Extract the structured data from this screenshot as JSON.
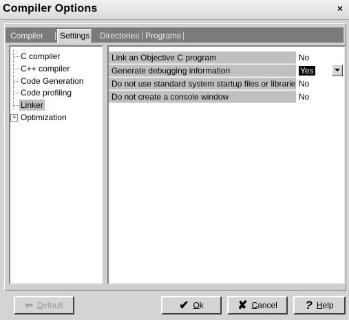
{
  "window": {
    "title": "Compiler Options",
    "close_glyph": "×"
  },
  "tabs": [
    {
      "label": "Compiler"
    },
    {
      "label": "Settings",
      "active": true
    },
    {
      "label": "Directories"
    },
    {
      "label": "Programs"
    }
  ],
  "tree": {
    "items": [
      {
        "label": "C compiler"
      },
      {
        "label": "C++ compiler"
      },
      {
        "label": "Code Generation"
      },
      {
        "label": "Code profiling"
      },
      {
        "label": "Linker",
        "selected": true
      },
      {
        "label": "Optimization",
        "expander": "+"
      }
    ]
  },
  "settings": {
    "rows": [
      {
        "name": "Link an Objective C program",
        "value": "No"
      },
      {
        "name": "Generate debugging information",
        "value": "Yes",
        "editing": true
      },
      {
        "name": "Do not use standard system startup files or libraries",
        "value": "No"
      },
      {
        "name": "Do not create a console window",
        "value": "No"
      }
    ]
  },
  "buttons": {
    "default": {
      "label": "Default",
      "accel": "D",
      "rest": "efault",
      "icon": "back-arrow-icon",
      "glyph": "⇐",
      "enabled": false
    },
    "ok": {
      "label": "Ok",
      "accel": "O",
      "rest": "k",
      "icon": "checkmark-icon",
      "glyph": "✔"
    },
    "cancel": {
      "label": "Cancel",
      "accel": "C",
      "rest": "ancel",
      "icon": "cancel-x-icon",
      "glyph": "✘"
    },
    "help": {
      "label": "Help",
      "accel": "H",
      "rest": "elp",
      "icon": "question-mark-icon",
      "glyph": "?"
    }
  },
  "colors": {
    "selected_bg": "#c0c0c0",
    "tab_bar_bg": "#7b7b7b",
    "edit_highlight": "#000000"
  }
}
